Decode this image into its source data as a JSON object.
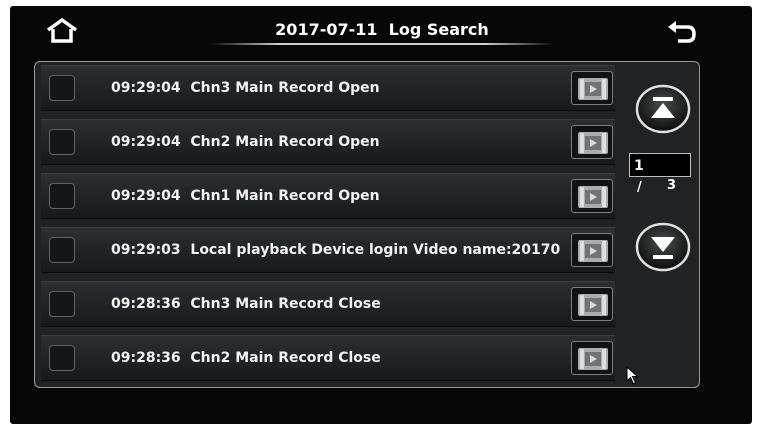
{
  "header": {
    "title": "2017-07-11  Log Search",
    "home_icon": "home-icon",
    "back_icon": "back-arrow-icon"
  },
  "log_list": {
    "rows": [
      {
        "text": "09:29:04  Chn3 Main Record Open",
        "checked": false
      },
      {
        "text": "09:29:04  Chn2 Main Record Open",
        "checked": false
      },
      {
        "text": "09:29:04  Chn1 Main Record Open",
        "checked": false
      },
      {
        "text": "09:29:03  Local playback Device login Video name:20170",
        "checked": false
      },
      {
        "text": "09:28:36  Chn3 Main Record Close",
        "checked": false
      },
      {
        "text": "09:28:36  Chn2 Main Record Close",
        "checked": false
      }
    ],
    "play_icon": "video-playback-icon"
  },
  "pager": {
    "current_page": "1",
    "separator": "/",
    "total_pages": "3",
    "prev_icon": "page-up-icon",
    "next_icon": "page-down-icon"
  },
  "colors": {
    "screen_bg": "#070707",
    "panel_bg": "#202224",
    "text": "#f2f2f2",
    "border": "#9a9a9a"
  }
}
